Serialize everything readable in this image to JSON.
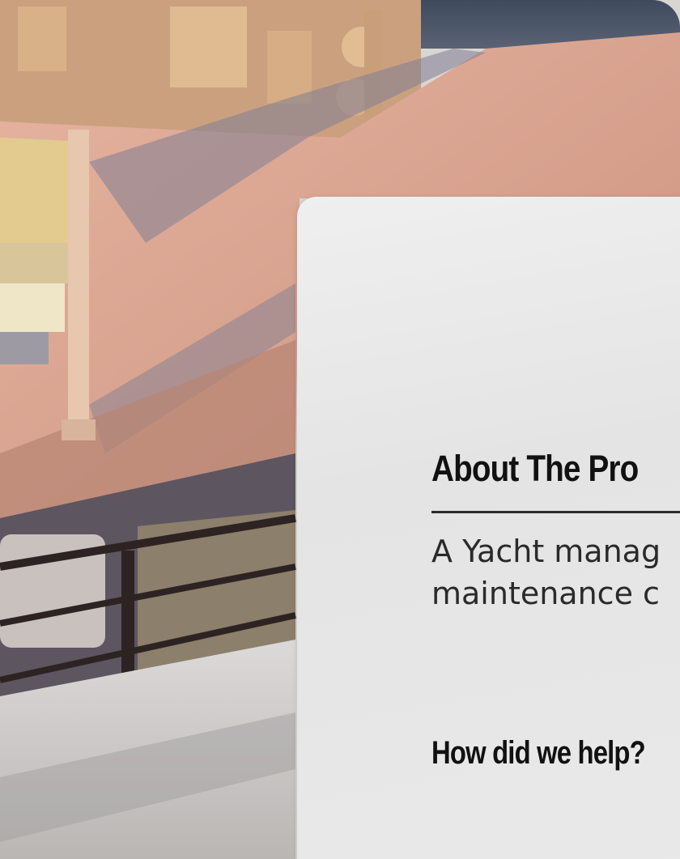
{
  "project_card": {
    "title": "About The Pro",
    "description_lines": [
      "A Yacht manag",
      "maintenance c"
    ],
    "subheading": "How did we help?"
  },
  "colors": {
    "deck": "#d9a694",
    "card_background": "#e9e9e9",
    "text": "#111111"
  },
  "icons": []
}
